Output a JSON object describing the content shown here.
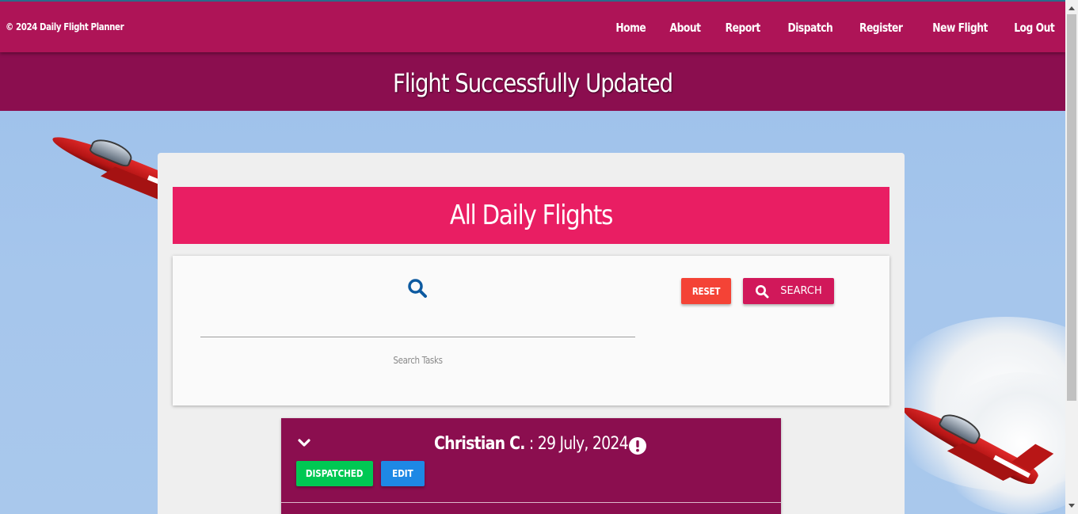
{
  "nav": {
    "brand": "© 2024 Daily Flight Planner",
    "links": [
      "Home",
      "About",
      "Report",
      "Dispatch",
      "Register",
      "New Flight",
      "Log Out"
    ]
  },
  "banner": {
    "message": "Flight Successfully Updated"
  },
  "main": {
    "title": "All Daily Flights",
    "search": {
      "icon": "search-icon",
      "value": "",
      "label": "Search Tasks",
      "reset_label": "RESET",
      "search_label": "SEARCH"
    },
    "flights": [
      {
        "name": "Christian C.",
        "separator": " : ",
        "date": "29 July, 2024",
        "status_label": "DISPATCHED",
        "edit_label": "EDIT",
        "icons": [
          "chevron-down-icon",
          "alert-icon"
        ]
      }
    ]
  },
  "colors": {
    "navbar": "#ae1457",
    "banner": "#8b0e4f",
    "header": "#e91e63",
    "reset": "#f44336",
    "search": "#d1185a",
    "dispatched": "#00c853",
    "edit": "#1e88e5",
    "search_icon": "#0d5aa0"
  }
}
